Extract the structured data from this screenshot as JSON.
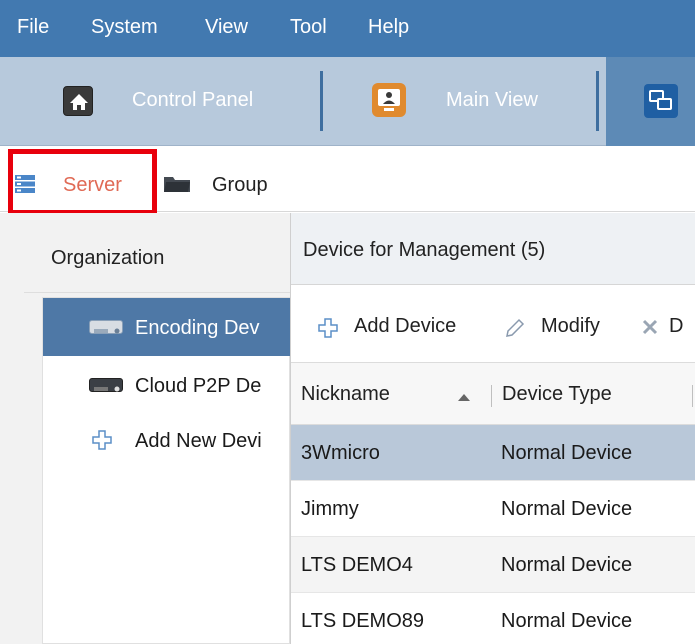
{
  "menubar": {
    "items": [
      "File",
      "System",
      "View",
      "Tool",
      "Help"
    ]
  },
  "toolbar": {
    "control_panel": "Control Panel",
    "main_view": "Main View"
  },
  "tabs": {
    "server": "Server",
    "group": "Group"
  },
  "organization": {
    "title": "Organization",
    "items": [
      {
        "label": "Encoding Dev"
      },
      {
        "label": "Cloud P2P De"
      },
      {
        "label": "Add New Devi"
      }
    ]
  },
  "management": {
    "title": "Device for Management (5)",
    "actions": {
      "add": "Add Device",
      "modify": "Modify",
      "delete": "D"
    },
    "columns": {
      "nickname": "Nickname",
      "device_type": "Device Type"
    },
    "rows": [
      {
        "nickname": "3Wmicro",
        "device_type": "Normal Device"
      },
      {
        "nickname": "Jimmy",
        "device_type": "Normal Device"
      },
      {
        "nickname": "LTS DEMO4",
        "device_type": "Normal Device"
      },
      {
        "nickname": "LTS DEMO89",
        "device_type": "Normal Device"
      }
    ]
  },
  "colors": {
    "menubar": "#4279b0",
    "toolbar": "#b7c9dc",
    "selected_tree": "#4e78a6",
    "selected_row": "#b9c8d9",
    "highlight": "#e8000c"
  }
}
